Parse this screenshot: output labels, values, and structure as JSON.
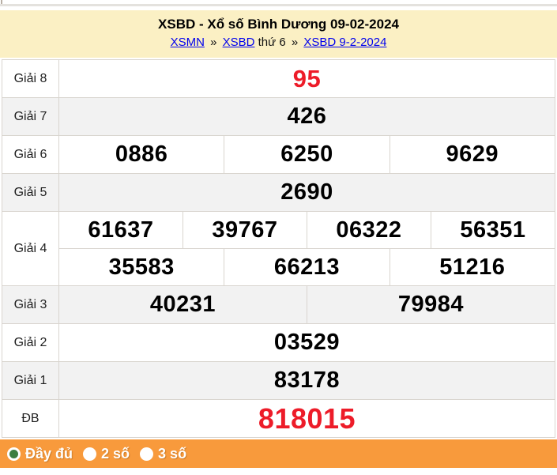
{
  "header": {
    "title": "XSBD - Xổ số Bình Dương 09-02-2024",
    "breadcrumb": {
      "xsmn": "XSMN",
      "separator": "»",
      "xsbd": "XSBD",
      "weekday": "thứ 6",
      "date_link": "XSBD 9-2-2024"
    }
  },
  "results": {
    "rows": [
      {
        "label": "Giải 8",
        "numbers": [
          "95"
        ]
      },
      {
        "label": "Giải 7",
        "numbers": [
          "426"
        ]
      },
      {
        "label": "Giải 6",
        "numbers": [
          "0886",
          "6250",
          "9629"
        ]
      },
      {
        "label": "Giải 5",
        "numbers": [
          "2690"
        ]
      },
      {
        "label": "Giải 4",
        "row1": [
          "61637",
          "39767",
          "06322",
          "56351"
        ],
        "row2": [
          "35583",
          "66213",
          "51216"
        ]
      },
      {
        "label": "Giải 3",
        "numbers": [
          "40231",
          "79984"
        ]
      },
      {
        "label": "Giải 2",
        "numbers": [
          "03529"
        ]
      },
      {
        "label": "Giải 1",
        "numbers": [
          "83178"
        ]
      },
      {
        "label": "ĐB",
        "numbers": [
          "818015"
        ]
      }
    ]
  },
  "footer": {
    "options": [
      {
        "label": "Đầy đủ",
        "selected": true
      },
      {
        "label": "2 số",
        "selected": false
      },
      {
        "label": "3 số",
        "selected": false
      }
    ]
  },
  "colors": {
    "header_bg": "#FBF0C4",
    "link_blue": "#0000EE",
    "accent_red": "#ED1C29",
    "row_alt_bg": "#F2F2F2",
    "cell_border": "#D9D5CF",
    "footer_orange": "#F89A3C",
    "radio_green": "#3C7D3F"
  }
}
